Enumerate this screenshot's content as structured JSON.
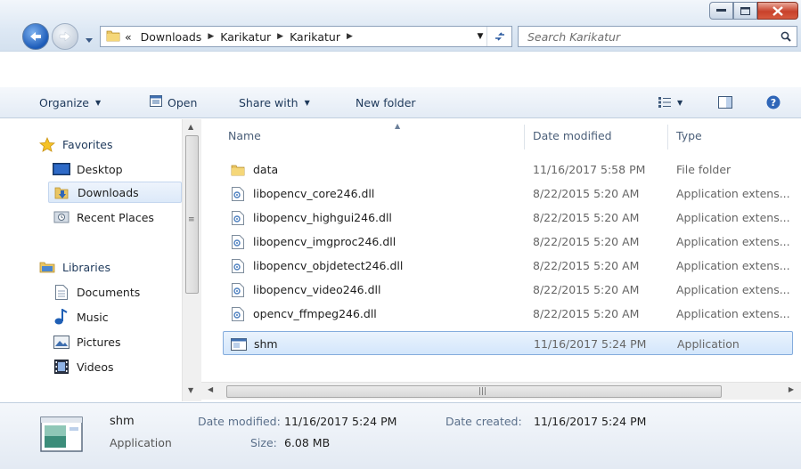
{
  "window": {
    "controls": [
      "minimize",
      "maximize",
      "close"
    ]
  },
  "address": {
    "overflow": "«",
    "crumbs": [
      "Downloads",
      "Karikatur",
      "Karikatur"
    ],
    "search_placeholder": "Search Karikatur"
  },
  "toolbar": {
    "organize": "Organize",
    "open": "Open",
    "share": "Share with",
    "new_folder": "New folder"
  },
  "sidebar": {
    "favorites": "Favorites",
    "favorite_items": [
      "Desktop",
      "Downloads",
      "Recent Places"
    ],
    "libraries": "Libraries",
    "library_items": [
      "Documents",
      "Music",
      "Pictures",
      "Videos"
    ],
    "selected": "Downloads"
  },
  "columns": {
    "name": "Name",
    "date": "Date modified",
    "type": "Type"
  },
  "files": [
    {
      "name": "data",
      "date": "11/16/2017 5:58 PM",
      "type": "File folder",
      "icon": "folder-icon"
    },
    {
      "name": "libopencv_core246.dll",
      "date": "8/22/2015 5:20 AM",
      "type": "Application extens...",
      "icon": "dll-icon"
    },
    {
      "name": "libopencv_highgui246.dll",
      "date": "8/22/2015 5:20 AM",
      "type": "Application extens...",
      "icon": "dll-icon"
    },
    {
      "name": "libopencv_imgproc246.dll",
      "date": "8/22/2015 5:20 AM",
      "type": "Application extens...",
      "icon": "dll-icon"
    },
    {
      "name": "libopencv_objdetect246.dll",
      "date": "8/22/2015 5:20 AM",
      "type": "Application extens...",
      "icon": "dll-icon"
    },
    {
      "name": "libopencv_video246.dll",
      "date": "8/22/2015 5:20 AM",
      "type": "Application extens...",
      "icon": "dll-icon"
    },
    {
      "name": "opencv_ffmpeg246.dll",
      "date": "8/22/2015 5:20 AM",
      "type": "Application extens...",
      "icon": "dll-icon"
    },
    {
      "name": "shm",
      "date": "11/16/2017 5:24 PM",
      "type": "Application",
      "icon": "application-icon",
      "selected": true
    }
  ],
  "details": {
    "name": "shm",
    "kind": "Application",
    "modified_label": "Date modified:",
    "modified_value": "11/16/2017 5:24 PM",
    "size_label": "Size:",
    "size_value": "6.08 MB",
    "created_label": "Date created:",
    "created_value": "11/16/2017 5:24 PM"
  },
  "colors": {
    "accent": "#1c5bb8",
    "selection_border": "#84acdd",
    "close_button": "#c8412b"
  }
}
